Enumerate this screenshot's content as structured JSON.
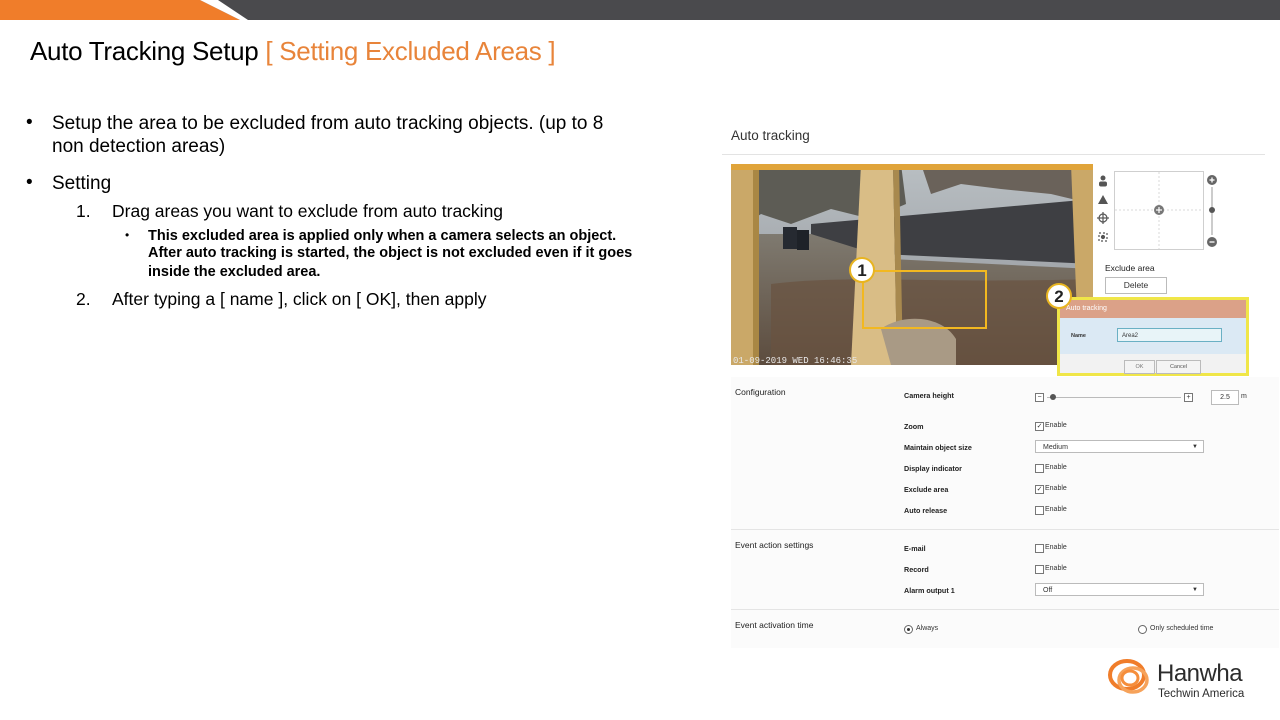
{
  "slide": {
    "title_main": "Auto Tracking Setup",
    "title_accent": "[ Setting Excluded Areas ]",
    "bullets": {
      "b1_line1": "Setup the area to be excluded  from auto tracking objects. (up to 8",
      "b1_line2": "non detection areas)",
      "b2": "Setting",
      "s1_num": "1.",
      "s1": "Drag areas you want to exclude from auto tracking",
      "ss1_line1": "This excluded area is applied only when a camera selects an object.",
      "ss1_line2": "After auto tracking is started, the object is not excluded even if it goes",
      "ss1_line3": "inside the excluded area.",
      "s2_num": "2.",
      "s2": "After typing a [ name ], click on [ OK], then apply"
    }
  },
  "panel": {
    "header": "Auto tracking",
    "video_timestamp": "01-09-2019 WED 16:46:35",
    "badge1": "1",
    "badge2": "2",
    "exclude_area_label": "Exclude area",
    "delete_button": "Delete",
    "dialog": {
      "title": "Auto tracking",
      "name_label": "Name",
      "name_value": "Area2",
      "ok": "OK",
      "cancel": "Cancel"
    },
    "config": {
      "section_configuration": "Configuration",
      "camera_height_label": "Camera height",
      "camera_height_value": "2.5",
      "camera_height_unit": "m",
      "camera_height_level": 0.02,
      "zoom_label": "Zoom",
      "zoom_enable": "Enable",
      "maintain_label": "Maintain object size",
      "maintain_value": "Medium",
      "display_label": "Display indicator",
      "display_enable": "Enable",
      "exclude_label": "Exclude area",
      "exclude_enable": "Enable",
      "auto_release_label": "Auto release",
      "auto_release_enable": "Enable",
      "section_event_action": "Event action settings",
      "email_label": "E-mail",
      "email_enable": "Enable",
      "record_label": "Record",
      "record_enable": "Enable",
      "alarm_label": "Alarm output 1",
      "alarm_value": "Off",
      "section_activation": "Event activation time",
      "always": "Always",
      "only_scheduled": "Only scheduled time"
    }
  },
  "logo": {
    "name": "Hanwha",
    "sub": "Techwin America"
  },
  "colors": {
    "accent_orange": "#e8843a",
    "banner_dark": "#4a4a4d",
    "highlight_yellow": "#f0e648",
    "badge_border": "#e8b420",
    "exclude_box": "#f2b820"
  }
}
